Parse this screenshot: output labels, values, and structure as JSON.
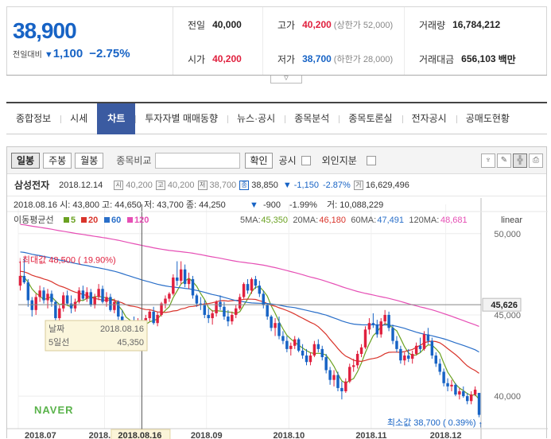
{
  "quote": {
    "price": "38,900",
    "change_label": "전일대비",
    "change_arrow": "▼",
    "change_amount": "1,100",
    "change_rate": "−2.75%",
    "cells": [
      {
        "key": "전일",
        "value": "40,000",
        "color": "",
        "sub": ""
      },
      {
        "key": "고가",
        "value": "40,200",
        "color": "red",
        "sub": "(상한가 52,000)"
      },
      {
        "key": "거래량",
        "value": "16,784,212",
        "color": "",
        "sub": ""
      },
      {
        "key": "시가",
        "value": "40,200",
        "color": "red",
        "sub": ""
      },
      {
        "key": "저가",
        "value": "38,700",
        "color": "blue",
        "sub": "(하한가 28,000)"
      },
      {
        "key": "거래대금",
        "value": "656,103",
        "color": "",
        "sub": "백만"
      }
    ],
    "expand_icon": "chevron-down-icon"
  },
  "tabs": [
    {
      "label": "종합정보",
      "active": false
    },
    {
      "label": "시세",
      "active": false
    },
    {
      "label": "차트",
      "active": true
    },
    {
      "label": "투자자별 매매동향",
      "active": false
    },
    {
      "label": "뉴스·공시",
      "active": false
    },
    {
      "label": "종목분석",
      "active": false
    },
    {
      "label": "종목토론실",
      "active": false
    },
    {
      "label": "전자공시",
      "active": false
    },
    {
      "label": "공매도현황",
      "active": false
    }
  ],
  "toolbar": {
    "periods": [
      {
        "label": "일봉",
        "active": true
      },
      {
        "label": "주봉",
        "active": false
      },
      {
        "label": "월봉",
        "active": false
      }
    ],
    "compare_label": "종목비교",
    "compare_value": "",
    "confirm_label": "확인",
    "disclosure_label": "공시",
    "foreign_label": "외인지분",
    "tool_icons": [
      "pin-icon",
      "pencil-icon",
      "cursor-icon",
      "print-icon"
    ]
  },
  "stock_line": {
    "name": "삼성전자",
    "date": "2018.12.14",
    "open_icon": "시",
    "open": "40,200",
    "high_icon": "고",
    "high": "40,200",
    "low_icon": "저",
    "low": "38,700",
    "close_icon": "종",
    "close": "38,850",
    "change_arrow": "▼",
    "change": "-1,150",
    "rate": "-2.87%",
    "volume_icon": "거",
    "volume": "16,629,496"
  },
  "chart_data": {
    "type": "candlestick",
    "info_line": "2018.08.16  시: 43,800  고: 44,650  저: 43,700  종: 44,250",
    "info_change": "-900",
    "info_rate": "-1.99%",
    "info_volume": "거: 10,088,229",
    "info_arrow": "▼",
    "ma_legend_label": "이동평균선",
    "ma_legend": [
      {
        "name": "5",
        "color": "#6aa121"
      },
      {
        "name": "20",
        "color": "#d9342b"
      },
      {
        "name": "60",
        "color": "#2a6fc9"
      },
      {
        "name": "120",
        "color": "#e64fb5"
      }
    ],
    "ma_values": [
      {
        "label": "5MA:",
        "value": "45,350",
        "color": "#6aa121"
      },
      {
        "label": "20MA:",
        "value": "46,180",
        "color": "#d9342b"
      },
      {
        "label": "60MA:",
        "value": "47,491",
        "color": "#2a6fc9"
      },
      {
        "label": "120MA:",
        "value": "48,681",
        "color": "#e64fb5"
      }
    ],
    "scale_label": "linear",
    "y_ticks": [
      "50,000",
      "45,000",
      "40,000"
    ],
    "y_tick_values": [
      50000,
      45000,
      40000
    ],
    "current_value_label": "45,626",
    "current_value": 45626,
    "ylim": [
      38000,
      51800
    ],
    "x_labels": [
      "2018.07",
      "2018.08",
      "2018.08.16",
      "2018.09",
      "2018.10",
      "2018.11",
      "2018.12"
    ],
    "x_label_index": [
      0,
      22,
      31,
      48,
      69,
      90,
      109
    ],
    "crosshair_index": 31,
    "max_label": "최대값 48,500 ( 19.90%)",
    "min_label": "최소값 38,700 ( 0.39%)",
    "max_index": 1,
    "min_index": 117,
    "tooltip": {
      "date_label": "날짜",
      "date": "2018.08.16",
      "ma_label": "5일선",
      "ma": "45,350"
    },
    "watermark": "NAVER",
    "colors": {
      "up": "#e0203e",
      "down": "#1763c5"
    },
    "candles": [
      [
        46800,
        48300,
        46500,
        47400
      ],
      [
        47400,
        48500,
        46900,
        47000
      ],
      [
        47000,
        47200,
        45500,
        45900
      ],
      [
        45900,
        46100,
        44900,
        45300
      ],
      [
        45300,
        46300,
        45000,
        46100
      ],
      [
        46100,
        46800,
        45800,
        46500
      ],
      [
        46500,
        46700,
        45700,
        45900
      ],
      [
        45900,
        46600,
        45400,
        46300
      ],
      [
        46300,
        46500,
        45500,
        45800
      ],
      [
        45800,
        45900,
        44600,
        44800
      ],
      [
        44800,
        45600,
        44500,
        45400
      ],
      [
        45400,
        46400,
        45200,
        46200
      ],
      [
        46200,
        46500,
        45600,
        45700
      ],
      [
        45700,
        46200,
        45100,
        45400
      ],
      [
        45400,
        46000,
        45200,
        45800
      ],
      [
        45800,
        46700,
        45700,
        46500
      ],
      [
        46500,
        46800,
        45900,
        46000
      ],
      [
        46000,
        46700,
        45800,
        46400
      ],
      [
        46400,
        46600,
        45500,
        45600
      ],
      [
        45600,
        46300,
        45400,
        46100
      ],
      [
        46100,
        46900,
        45900,
        46600
      ],
      [
        46600,
        46800,
        45700,
        45800
      ],
      [
        45800,
        46400,
        45500,
        46100
      ],
      [
        46100,
        46300,
        45200,
        45300
      ],
      [
        45300,
        46000,
        45100,
        45800
      ],
      [
        45800,
        45900,
        44700,
        44900
      ],
      [
        44900,
        45300,
        44100,
        44300
      ],
      [
        44300,
        44600,
        43700,
        44000
      ],
      [
        44000,
        44600,
        43700,
        44400
      ],
      [
        44400,
        44900,
        43900,
        44100
      ],
      [
        44100,
        44800,
        43800,
        44500
      ],
      [
        43800,
        44650,
        43700,
        44250
      ],
      [
        44250,
        45000,
        44100,
        44800
      ],
      [
        44800,
        45300,
        44600,
        45200
      ],
      [
        45200,
        45500,
        44400,
        44500
      ],
      [
        44500,
        45200,
        44300,
        45000
      ],
      [
        45000,
        45800,
        44900,
        45700
      ],
      [
        45700,
        46200,
        45400,
        46000
      ],
      [
        46000,
        46400,
        45800,
        46300
      ],
      [
        46300,
        47500,
        46200,
        47300
      ],
      [
        47300,
        48300,
        46800,
        47100
      ],
      [
        47100,
        48300,
        46900,
        47800
      ],
      [
        47800,
        48100,
        46700,
        46900
      ],
      [
        46900,
        47600,
        46600,
        47200
      ],
      [
        47200,
        47400,
        46000,
        46200
      ],
      [
        46200,
        46300,
        45500,
        45700
      ],
      [
        45700,
        46100,
        45300,
        45600
      ],
      [
        45600,
        45900,
        44800,
        45000
      ],
      [
        45000,
        45400,
        44500,
        44800
      ],
      [
        44800,
        45300,
        44400,
        45100
      ],
      [
        45100,
        45900,
        44900,
        45800
      ],
      [
        45800,
        46200,
        45300,
        45500
      ],
      [
        45500,
        45800,
        44700,
        44900
      ],
      [
        44900,
        45300,
        44300,
        44600
      ],
      [
        44600,
        45200,
        44400,
        45000
      ],
      [
        45000,
        45600,
        44800,
        45400
      ],
      [
        45400,
        46300,
        45300,
        46100
      ],
      [
        46100,
        47000,
        46000,
        46900
      ],
      [
        46900,
        47200,
        46300,
        46500
      ],
      [
        46500,
        47300,
        46300,
        47200
      ],
      [
        47200,
        47400,
        46600,
        46800
      ],
      [
        46800,
        47100,
        46100,
        46300
      ],
      [
        46300,
        46500,
        45400,
        45600
      ],
      [
        45600,
        45700,
        44700,
        44900
      ],
      [
        44900,
        45000,
        44000,
        44200
      ],
      [
        44200,
        44800,
        43700,
        44500
      ],
      [
        44500,
        44900,
        43500,
        43700
      ],
      [
        43700,
        44000,
        43200,
        43400
      ],
      [
        43400,
        43700,
        42700,
        42900
      ],
      [
        42900,
        43300,
        42500,
        43100
      ],
      [
        43100,
        43700,
        42900,
        43500
      ],
      [
        43500,
        43600,
        42700,
        42800
      ],
      [
        42800,
        43200,
        42300,
        42500
      ],
      [
        42500,
        42900,
        41900,
        42100
      ],
      [
        42100,
        42700,
        41900,
        42500
      ],
      [
        42500,
        43400,
        42400,
        43200
      ],
      [
        43200,
        43500,
        42700,
        42900
      ],
      [
        42900,
        43100,
        42200,
        42400
      ],
      [
        42400,
        42600,
        41400,
        41600
      ],
      [
        41600,
        41800,
        40700,
        41000
      ],
      [
        41000,
        41600,
        40600,
        41300
      ],
      [
        41300,
        41500,
        40300,
        40500
      ],
      [
        40500,
        40900,
        39800,
        40300
      ],
      [
        40300,
        41100,
        40200,
        40900
      ],
      [
        40900,
        42000,
        40800,
        41800
      ],
      [
        41800,
        42300,
        41500,
        41900
      ],
      [
        41900,
        42800,
        41700,
        42600
      ],
      [
        42600,
        43200,
        42400,
        43000
      ],
      [
        43000,
        44300,
        42900,
        44100
      ],
      [
        44100,
        44800,
        43800,
        44500
      ],
      [
        44500,
        45100,
        44200,
        44400
      ],
      [
        44400,
        44700,
        43600,
        43800
      ],
      [
        43800,
        44800,
        43600,
        44600
      ],
      [
        44600,
        45300,
        44400,
        45000
      ],
      [
        45000,
        45200,
        44000,
        44200
      ],
      [
        44200,
        44400,
        43200,
        43400
      ],
      [
        43400,
        43700,
        42700,
        42900
      ],
      [
        42900,
        43100,
        42000,
        42200
      ],
      [
        42200,
        42700,
        41900,
        42500
      ],
      [
        42500,
        42900,
        42100,
        42300
      ],
      [
        42300,
        42800,
        42000,
        42600
      ],
      [
        42600,
        43300,
        42500,
        43100
      ],
      [
        43100,
        43600,
        42700,
        42900
      ],
      [
        42900,
        44000,
        42800,
        43800
      ],
      [
        43800,
        44200,
        43200,
        43400
      ],
      [
        43400,
        43600,
        42300,
        42500
      ],
      [
        42500,
        42700,
        41800,
        42000
      ],
      [
        42000,
        42300,
        41300,
        41500
      ],
      [
        41500,
        41700,
        40600,
        40800
      ],
      [
        40800,
        41100,
        40300,
        40600
      ],
      [
        40600,
        41000,
        40300,
        40700
      ],
      [
        40700,
        40800,
        40000,
        40100
      ],
      [
        40100,
        40500,
        39800,
        40300
      ],
      [
        40300,
        40600,
        39900,
        40000
      ],
      [
        40000,
        40200,
        39500,
        39700
      ],
      [
        39700,
        40300,
        39500,
        40100
      ],
      [
        40100,
        40600,
        40000,
        40400
      ],
      [
        40200,
        40200,
        38700,
        38850
      ]
    ]
  }
}
